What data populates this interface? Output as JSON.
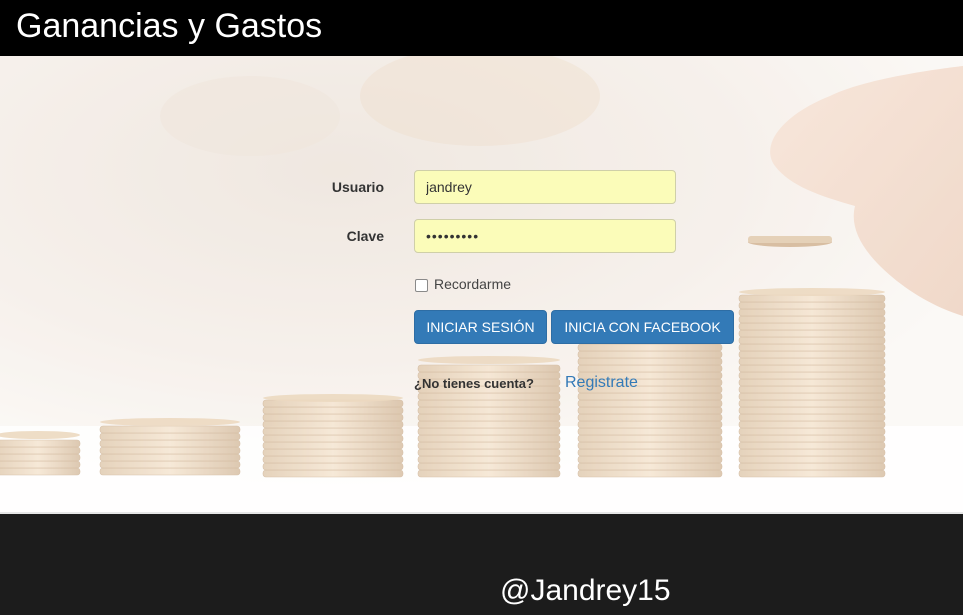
{
  "header": {
    "title": "Ganancias y Gastos"
  },
  "login": {
    "username_label": "Usuario",
    "username_value": "jandrey",
    "password_label": "Clave",
    "password_value": "•••••••••",
    "remember_label": "Recordarme",
    "remember_checked": false,
    "login_button": "INICIAR SESIÓN",
    "facebook_button": "INICIA CON FACEBOOK",
    "no_account_text": "¿No tienes cuenta?",
    "register_link": "Registrate"
  },
  "footer": {
    "handle": "@Jandrey15"
  },
  "colors": {
    "header_bg": "#000000",
    "input_bg": "#fbfcb9",
    "button_primary": "#337ab7",
    "link": "#337ab7",
    "footer_bg": "#1c1c1c"
  },
  "background_image": "coin-stacks-photo"
}
